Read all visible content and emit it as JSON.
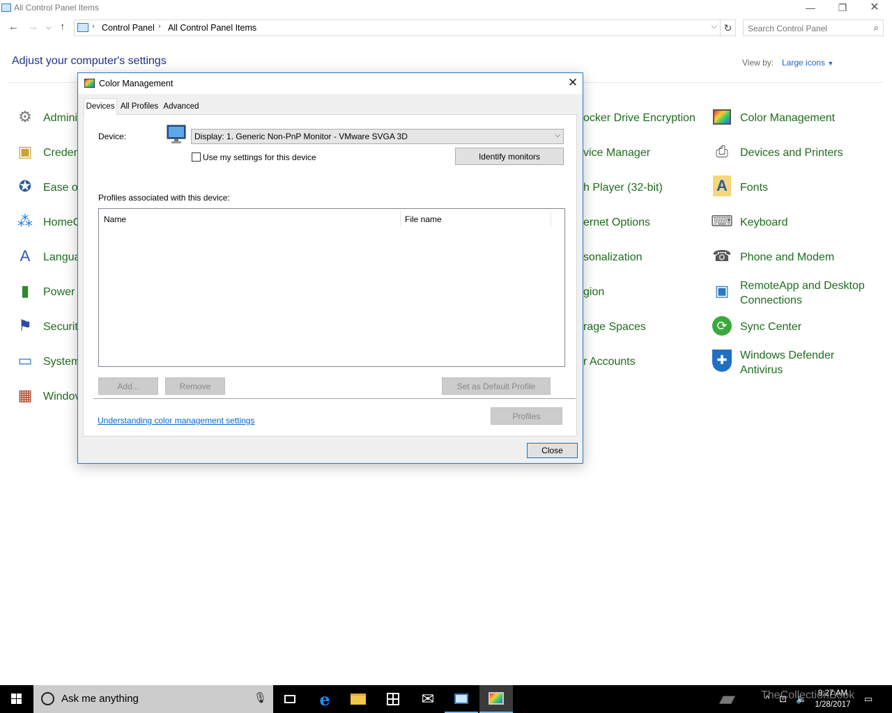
{
  "window": {
    "title": "All Control Panel Items",
    "min_glyph": "—",
    "max_glyph": "❐",
    "close_glyph": "✕"
  },
  "nav": {
    "breadcrumb": [
      "Control Panel",
      "All Control Panel Items"
    ],
    "search_placeholder": "Search Control Panel"
  },
  "page": {
    "heading": "Adjust your computer's settings",
    "view_by_label": "View by:",
    "view_by_value": "Large icons"
  },
  "items": {
    "left": [
      {
        "label": "Admini",
        "icon": "admin-tools-icon"
      },
      {
        "label": "Creden",
        "icon": "credential-manager-icon"
      },
      {
        "label": "Ease of",
        "icon": "ease-of-access-icon"
      },
      {
        "label": "HomeG",
        "icon": "homegroup-icon"
      },
      {
        "label": "Langua",
        "icon": "language-icon"
      },
      {
        "label": "Power (",
        "icon": "power-options-icon"
      },
      {
        "label": "Securit",
        "icon": "security-maintenance-icon"
      },
      {
        "label": "System",
        "icon": "system-icon"
      },
      {
        "label": "Windov",
        "icon": "windows-firewall-icon"
      }
    ],
    "middle": [
      {
        "label": "ocker Drive Encryption"
      },
      {
        "label": "vice Manager"
      },
      {
        "label": "h Player (32-bit)"
      },
      {
        "label": "ernet Options"
      },
      {
        "label": "sonalization"
      },
      {
        "label": "gion"
      },
      {
        "label": "rage Spaces"
      },
      {
        "label": "r Accounts"
      }
    ],
    "right": [
      {
        "label": "Color Management",
        "icon": "color-management-icon"
      },
      {
        "label": "Devices and Printers",
        "icon": "devices-printers-icon"
      },
      {
        "label": "Fonts",
        "icon": "fonts-icon"
      },
      {
        "label": "Keyboard",
        "icon": "keyboard-icon"
      },
      {
        "label": "Phone and Modem",
        "icon": "phone-modem-icon"
      },
      {
        "label": "RemoteApp and Desktop Connections",
        "icon": "remoteapp-icon"
      },
      {
        "label": "Sync Center",
        "icon": "sync-center-icon"
      },
      {
        "label": "Windows Defender Antivirus",
        "icon": "windows-defender-icon"
      }
    ]
  },
  "dialog": {
    "title": "Color Management",
    "tabs": [
      "Devices",
      "All Profiles",
      "Advanced"
    ],
    "active_tab": "Devices",
    "device_label": "Device:",
    "device_value": "Display: 1. Generic Non-PnP Monitor - VMware SVGA 3D",
    "use_settings_label": "Use my settings for this device",
    "use_settings_checked": false,
    "identify_button": "Identify monitors",
    "profiles_label": "Profiles associated with this device:",
    "columns": [
      "Name",
      "File name"
    ],
    "rows": [],
    "add_button": "Add...",
    "remove_button": "Remove",
    "set_default_button": "Set as Default Profile",
    "profiles_button": "Profiles",
    "help_link": "Understanding color management settings",
    "close_button": "Close"
  },
  "taskbar": {
    "search_text": "Ask me anything",
    "time": "9:27 AM",
    "date": "1/28/2017",
    "watermark": "TheCollectionBook"
  },
  "colors": {
    "link_green": "#1e6b1e",
    "heading_blue": "#1e3287",
    "accent_blue": "#2b79c2",
    "taskbar": "#000000"
  }
}
